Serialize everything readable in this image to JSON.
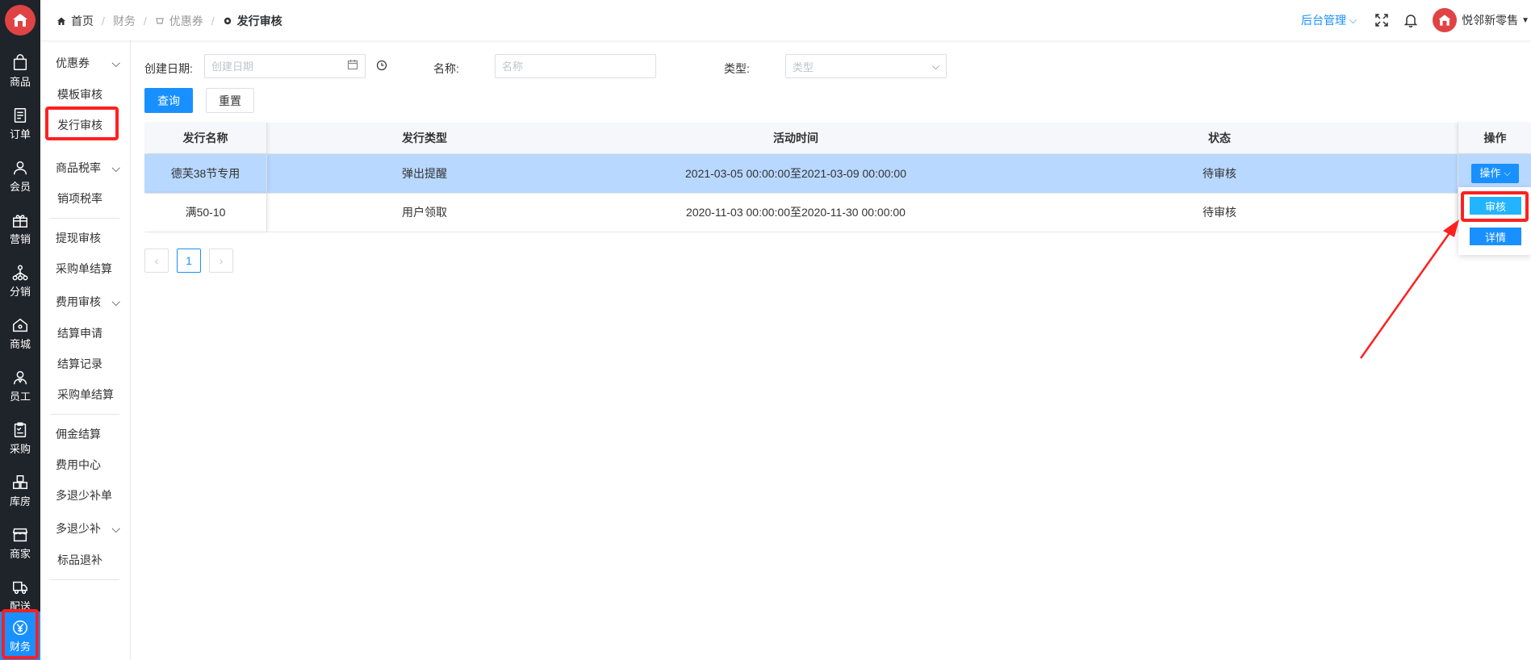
{
  "header": {
    "breadcrumb": {
      "home": "首页",
      "finance": "财务",
      "coupon": "优惠券",
      "current": "发行审核"
    },
    "admin_menu": "后台管理",
    "user_name": "悦邻新零售"
  },
  "rail": {
    "items": [
      {
        "label": "商品",
        "icon": "bag-icon"
      },
      {
        "label": "订单",
        "icon": "order-icon"
      },
      {
        "label": "会员",
        "icon": "user-icon"
      },
      {
        "label": "营销",
        "icon": "gift-icon"
      },
      {
        "label": "分销",
        "icon": "network-icon"
      },
      {
        "label": "商城",
        "icon": "home-icon"
      },
      {
        "label": "员工",
        "icon": "staff-icon"
      },
      {
        "label": "采购",
        "icon": "clipboard-icon"
      },
      {
        "label": "库房",
        "icon": "warehouse-icon"
      },
      {
        "label": "商家",
        "icon": "store-icon"
      },
      {
        "label": "配送",
        "icon": "delivery-icon"
      },
      {
        "label": "财务",
        "icon": "yuan-icon"
      }
    ]
  },
  "submenu": {
    "coupon": "优惠券",
    "template_review": "模板审核",
    "issue_review": "发行审核",
    "tax": "商品税率",
    "item_tax": "销项税率",
    "withdraw_review": "提现审核",
    "purchase_settle": "采购单结算",
    "expense_review": "费用审核",
    "settle_apply": "结算申请",
    "settle_record": "结算记录",
    "purchase_settle2": "采购单结算",
    "commission": "佣金结算",
    "expense_center": "费用中心",
    "refund_topup": "多退少补单",
    "refund_group": "多退少补",
    "std_refund": "标品退补"
  },
  "filters": {
    "date_label": "创建日期:",
    "date_placeholder": "创建日期",
    "name_label": "名称:",
    "name_placeholder": "名称",
    "type_label": "类型:",
    "type_placeholder": "类型",
    "query": "查询",
    "reset": "重置"
  },
  "table": {
    "columns": [
      "发行名称",
      "发行类型",
      "活动时间",
      "状态",
      "操作"
    ],
    "rows": [
      {
        "name": "德芙38节专用",
        "type": "弹出提醒",
        "time": "2021-03-05 00:00:00至2021-03-09 00:00:00",
        "status": "待审核"
      },
      {
        "name": "满50-10",
        "type": "用户领取",
        "time": "2020-11-03 00:00:00至2020-11-30 00:00:00",
        "status": "待审核"
      }
    ],
    "op_button": "操作",
    "dropdown": {
      "review": "审核",
      "detail": "详情"
    }
  },
  "pagination": {
    "current": "1"
  },
  "colors": {
    "primary": "#1890ff",
    "highlight": "#ff2020",
    "rail_bg": "#1f232a",
    "selected_row": "#b8d8ff"
  }
}
